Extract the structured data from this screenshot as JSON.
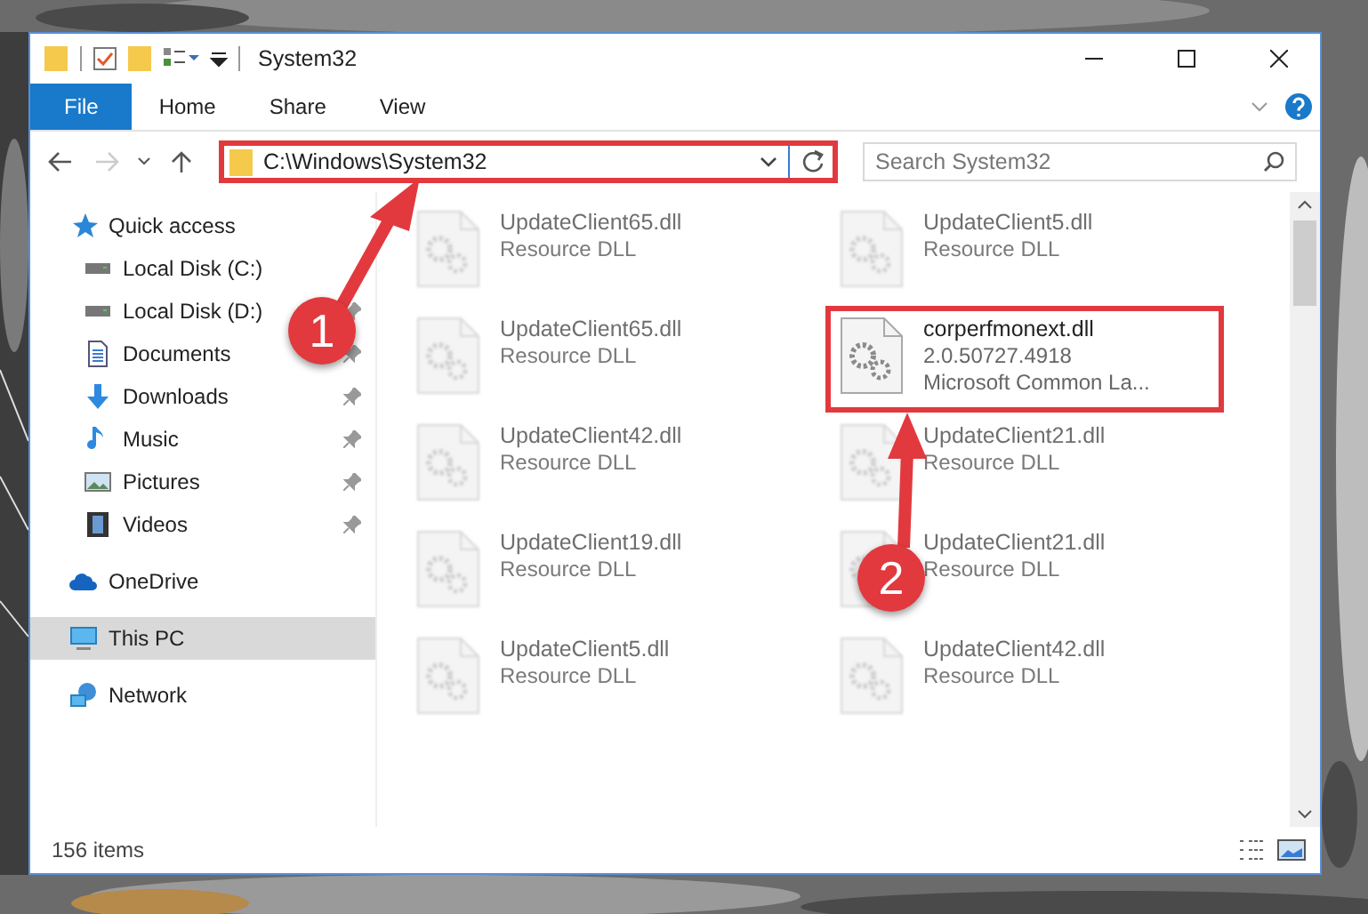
{
  "window": {
    "title": "System32"
  },
  "ribbon": {
    "tabs": [
      {
        "label": "File",
        "kind": "file"
      },
      {
        "label": "Home",
        "kind": "tab"
      },
      {
        "label": "Share",
        "kind": "tab"
      },
      {
        "label": "View",
        "kind": "tab"
      }
    ]
  },
  "address_bar": {
    "path": "C:\\Windows\\System32",
    "highlighted": true
  },
  "search": {
    "placeholder": "Search System32"
  },
  "sidebar": {
    "items": [
      {
        "label": "Quick access",
        "selected": false,
        "children": [
          {
            "label": "Local Disk (C:)",
            "pinned": false
          },
          {
            "label": "Local Disk (D:)",
            "pinned": true
          },
          {
            "label": "Documents",
            "pinned": true
          },
          {
            "label": "Downloads",
            "pinned": true
          },
          {
            "label": "Music",
            "pinned": true
          },
          {
            "label": "Pictures",
            "pinned": true
          },
          {
            "label": "Videos",
            "pinned": true
          }
        ]
      },
      {
        "label": "OneDrive",
        "selected": false
      },
      {
        "label": "This PC",
        "selected": true
      },
      {
        "label": "Network",
        "selected": false
      }
    ]
  },
  "files": [
    {
      "name": "UpdateClient65.dll",
      "lines": [
        "Resource DLL"
      ],
      "blurred": true,
      "highlighted": false
    },
    {
      "name": "UpdateClient5.dll",
      "lines": [
        "Resource DLL"
      ],
      "blurred": true,
      "highlighted": false
    },
    {
      "name": "UpdateClient65.dll",
      "lines": [
        "Resource DLL"
      ],
      "blurred": true,
      "highlighted": false
    },
    {
      "name": "corperfmonext.dll",
      "lines": [
        "2.0.50727.4918",
        "Microsoft Common La..."
      ],
      "blurred": false,
      "highlighted": true
    },
    {
      "name": "UpdateClient42.dll",
      "lines": [
        "Resource DLL"
      ],
      "blurred": true,
      "highlighted": false
    },
    {
      "name": "UpdateClient21.dll",
      "lines": [
        "Resource DLL"
      ],
      "blurred": true,
      "highlighted": false
    },
    {
      "name": "UpdateClient19.dll",
      "lines": [
        "Resource DLL"
      ],
      "blurred": true,
      "highlighted": false
    },
    {
      "name": "UpdateClient21.dll",
      "lines": [
        "Resource DLL"
      ],
      "blurred": true,
      "highlighted": false
    },
    {
      "name": "UpdateClient5.dll",
      "lines": [
        "Resource DLL"
      ],
      "blurred": true,
      "highlighted": false
    },
    {
      "name": "UpdateClient42.dll",
      "lines": [
        "Resource DLL"
      ],
      "blurred": true,
      "highlighted": false
    }
  ],
  "status_bar": {
    "count": "156 items"
  },
  "annotations": [
    {
      "number": "1"
    },
    {
      "number": "2"
    }
  ]
}
